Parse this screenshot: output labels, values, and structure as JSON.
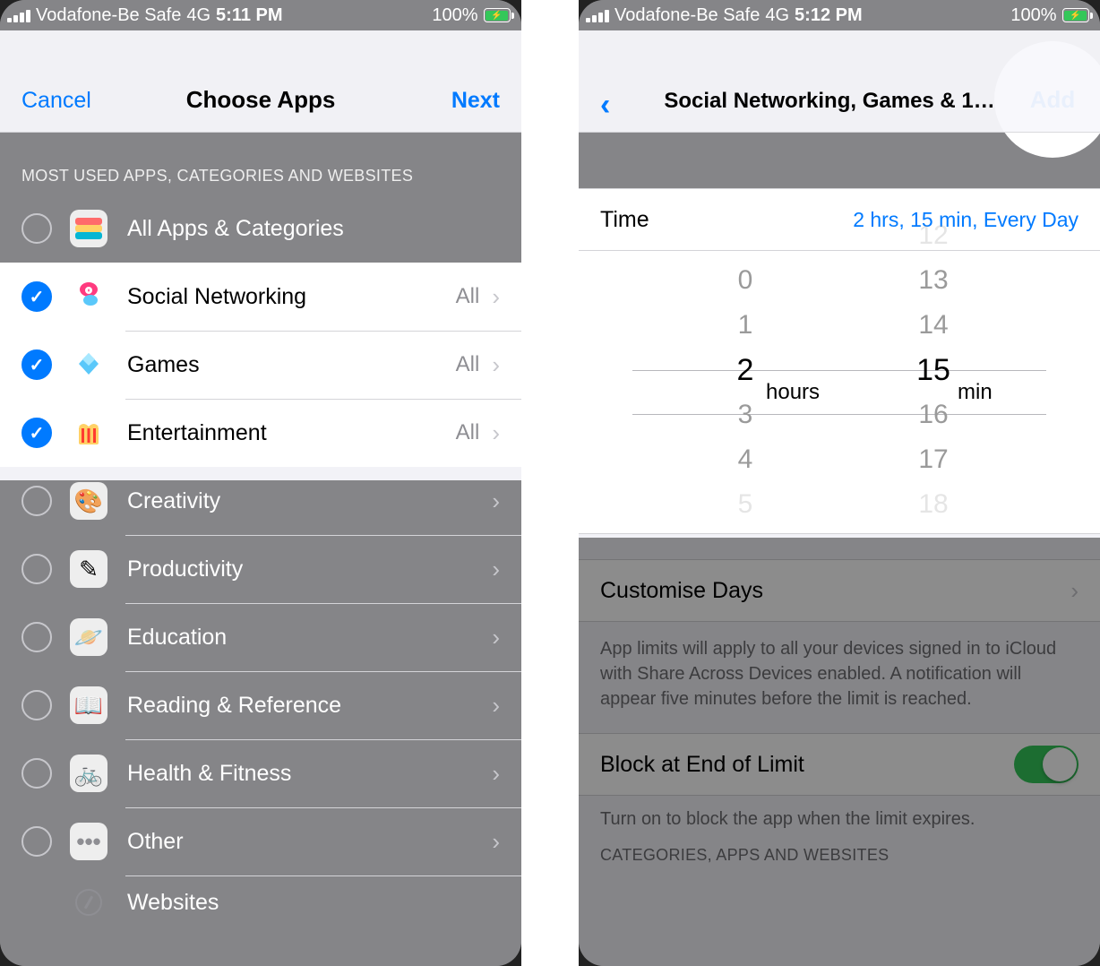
{
  "left": {
    "status": {
      "carrier": "Vodafone-Be Safe",
      "network": "4G",
      "time": "5:11 PM",
      "battery": "100%"
    },
    "nav": {
      "cancel": "Cancel",
      "title": "Choose Apps",
      "next": "Next"
    },
    "section_header": "MOST USED APPS, CATEGORIES AND WEBSITES",
    "rows": [
      {
        "label": "All Apps & Categories",
        "checked": false,
        "value": ""
      },
      {
        "label": "Social Networking",
        "checked": true,
        "value": "All"
      },
      {
        "label": "Games",
        "checked": true,
        "value": "All"
      },
      {
        "label": "Entertainment",
        "checked": true,
        "value": "All"
      },
      {
        "label": "Creativity",
        "checked": false,
        "value": ""
      },
      {
        "label": "Productivity",
        "checked": false,
        "value": ""
      },
      {
        "label": "Education",
        "checked": false,
        "value": ""
      },
      {
        "label": "Reading & Reference",
        "checked": false,
        "value": ""
      },
      {
        "label": "Health & Fitness",
        "checked": false,
        "value": ""
      },
      {
        "label": "Other",
        "checked": false,
        "value": ""
      },
      {
        "label": "Websites",
        "checked": false,
        "value": ""
      }
    ]
  },
  "right": {
    "status": {
      "carrier": "Vodafone-Be Safe",
      "network": "4G",
      "time": "5:12 PM",
      "battery": "100%"
    },
    "nav": {
      "title": "Social Networking, Games & 1…",
      "add": "Add"
    },
    "time_label": "Time",
    "time_value": "2 hrs, 15 min, Every Day",
    "picker": {
      "hours": [
        "0",
        "1",
        "2",
        "3",
        "4",
        "5"
      ],
      "hours_selected": "2",
      "hours_unit": "hours",
      "minutes": [
        "12",
        "13",
        "14",
        "15",
        "16",
        "17",
        "18"
      ],
      "minutes_selected": "15",
      "minutes_unit": "min"
    },
    "customise_label": "Customise Days",
    "info_text": "App limits will apply to all your devices signed in to iCloud with Share Across Devices enabled. A notification will appear five minutes before the limit is reached.",
    "block_label": "Block at End of Limit",
    "block_on": true,
    "block_hint": "Turn on to block the app when the limit expires.",
    "categories_header": "CATEGORIES, APPS AND WEBSITES"
  }
}
